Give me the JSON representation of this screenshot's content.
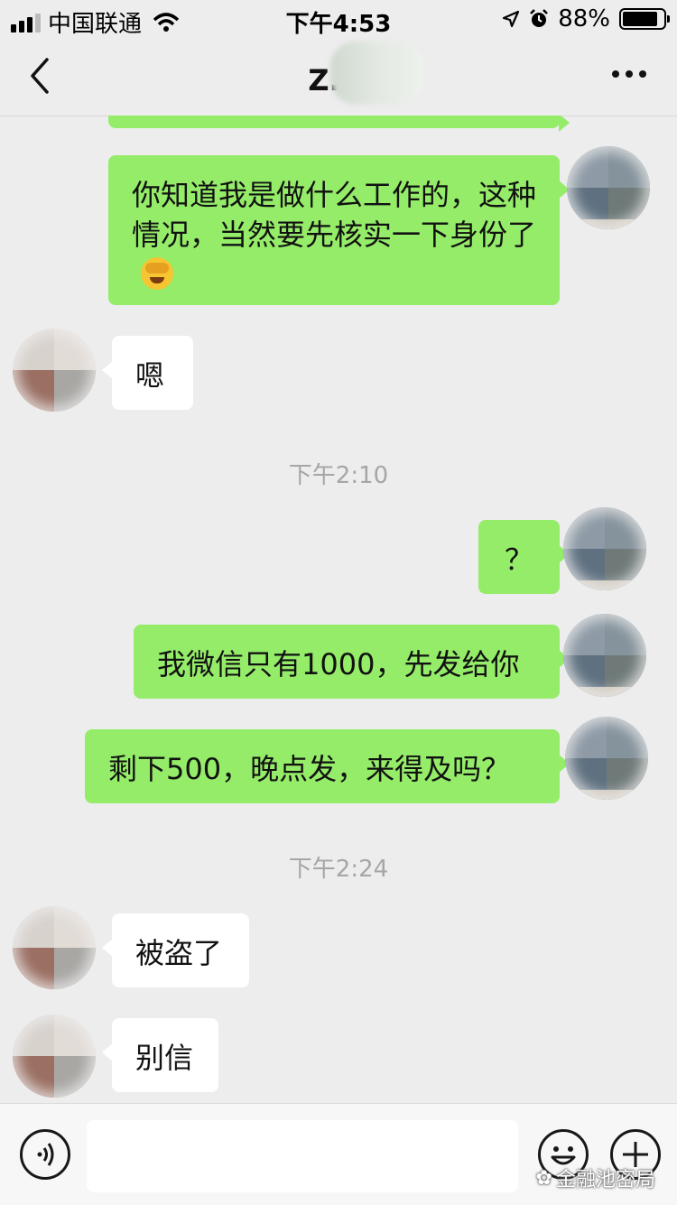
{
  "status_bar": {
    "carrier": "中国联通",
    "time": "下午4:53",
    "battery_percent": "88%",
    "battery_level": 0.88,
    "icons": [
      "signal-icon",
      "wifi-icon",
      "location-icon",
      "alarm-icon",
      "battery-icon"
    ]
  },
  "nav": {
    "title": "Z.沈",
    "back_icon": "chevron-left-icon",
    "more_icon": "more-dots-icon"
  },
  "messages": [
    {
      "side": "out",
      "text": "你知道我是做什么工作的，这种情况，当然要先核实一下身份了",
      "emoji": "facepalm-laugh-emoji"
    },
    {
      "side": "in",
      "text": "嗯"
    },
    {
      "type": "time",
      "text": "下午2:10"
    },
    {
      "side": "out",
      "text": "？"
    },
    {
      "side": "out",
      "text": "我微信只有1000，先发给你"
    },
    {
      "side": "out",
      "text": "剩下500，晚点发，来得及吗？"
    },
    {
      "type": "time",
      "text": "下午2:24"
    },
    {
      "side": "in",
      "text": "被盗了"
    },
    {
      "side": "in",
      "text": "别信"
    }
  ],
  "input_bar": {
    "voice_icon": "voice-icon",
    "emoji_icon": "smiley-icon",
    "plus_icon": "plus-icon",
    "text_value": "",
    "watermark": "金融池密局"
  },
  "colors": {
    "background": "#ededed",
    "outgoing_bubble": "#95ec69",
    "incoming_bubble": "#ffffff",
    "timestamp": "#a6a6a6"
  }
}
